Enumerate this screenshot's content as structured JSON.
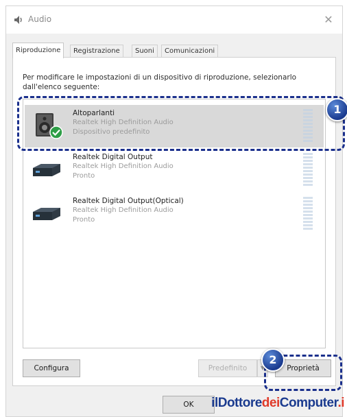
{
  "window": {
    "title": "Audio",
    "close_glyph": "✕",
    "icon": "speaker-icon"
  },
  "tabs": [
    {
      "label": "Riproduzione",
      "active": true
    },
    {
      "label": "Registrazione",
      "active": false
    },
    {
      "label": "Suoni",
      "active": false
    },
    {
      "label": "Comunicazioni",
      "active": false
    }
  ],
  "instruction": "Per modificare le impostazioni di un dispositivo di riproduzione, selezionarlo dall'elenco seguente:",
  "devices": [
    {
      "name": "Altoparlanti",
      "driver": "Realtek High Definition Audio",
      "status": "Dispositivo predefinito",
      "selected": true,
      "default": true,
      "icon": "speaker-device-icon"
    },
    {
      "name": "Realtek Digital Output",
      "driver": "Realtek High Definition Audio",
      "status": "Pronto",
      "selected": false,
      "default": false,
      "icon": "digital-output-icon"
    },
    {
      "name": "Realtek Digital Output(Optical)",
      "driver": "Realtek High Definition Audio",
      "status": "Pronto",
      "selected": false,
      "default": false,
      "icon": "digital-output-icon"
    }
  ],
  "buttons": {
    "configure": "Configura",
    "set_default": "Predefinito",
    "properties": "Proprietà",
    "ok": "OK",
    "dropdown_glyph": "▼"
  },
  "callouts": [
    {
      "number": "1",
      "color": "#1a2f8c"
    },
    {
      "number": "2",
      "color": "#1a2f8c"
    }
  ],
  "watermark": {
    "parts": [
      {
        "text": "il",
        "color": "#1b3b8f"
      },
      {
        "text": "Dottore",
        "color": "#1b3b8f"
      },
      {
        "text": "dei",
        "color": "#e03a2a"
      },
      {
        "text": "Computer",
        "color": "#1b3b8f"
      },
      {
        "text": ".i",
        "color": "#e03a2a"
      }
    ]
  },
  "colors": {
    "selected_row": "#d9d9d9",
    "default_check": "#2e9e47",
    "meter": "#d5e0ec"
  }
}
